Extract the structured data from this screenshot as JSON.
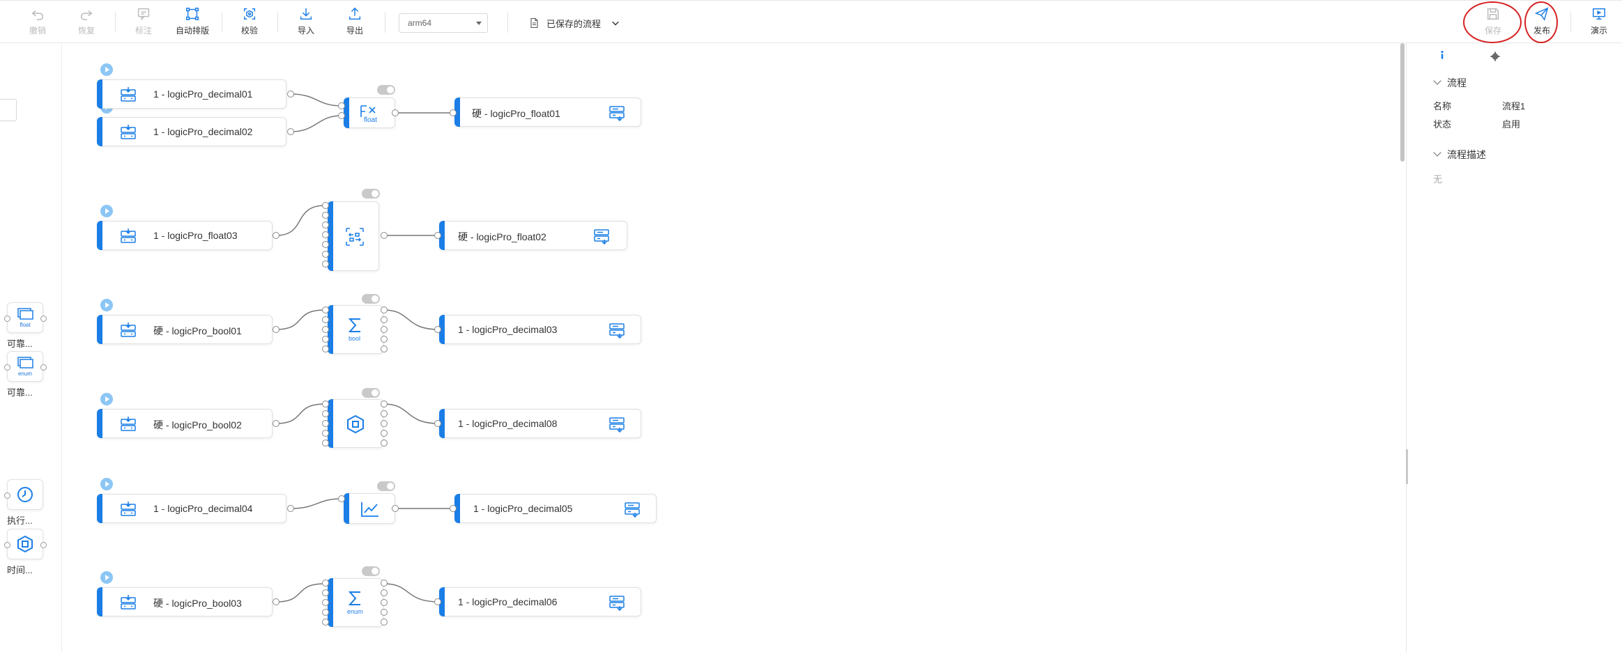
{
  "toolbar": {
    "undo": "撤销",
    "redo": "恢复",
    "annotate": "标注",
    "auto_layout": "自动排版",
    "validate": "校验",
    "import": "导入",
    "export": "导出",
    "arch_select": "arm64",
    "saved_flows": "已保存的流程",
    "save": "保存",
    "publish": "发布",
    "demo": "演示"
  },
  "palette": [
    {
      "label": "可靠...",
      "badge": "float"
    },
    {
      "label": "可靠...",
      "badge": "enum"
    },
    {
      "label": "执行...",
      "badge": ""
    },
    {
      "label": "时间...",
      "badge": ""
    }
  ],
  "flows": [
    {
      "inputs": [
        "1 - logicPro_decimal01",
        "1 - logicPro_decimal02"
      ],
      "func_badge": "float",
      "output": "硬 - logicPro_float01"
    },
    {
      "inputs": [
        "1 - logicPro_float03"
      ],
      "func_badge": "",
      "output": "硬 - logicPro_float02"
    },
    {
      "inputs": [
        "硬 - logicPro_bool01"
      ],
      "func_badge": "bool",
      "output": "1 - logicPro_decimal03"
    },
    {
      "inputs": [
        "硬 - logicPro_bool02"
      ],
      "func_badge": "",
      "output": "1 - logicPro_decimal08"
    },
    {
      "inputs": [
        "1 - logicPro_decimal04"
      ],
      "func_badge": "",
      "output": "1 - logicPro_decimal05"
    },
    {
      "inputs": [
        "硬 - logicPro_bool03"
      ],
      "func_badge": "enum",
      "output": "1 - logicPro_decimal06"
    }
  ],
  "properties": {
    "section_flow": "流程",
    "name_label": "名称",
    "name_value": "流程1",
    "status_label": "状态",
    "status_value": "启用",
    "section_desc": "流程描述",
    "desc_value": "无"
  },
  "colors": {
    "accent": "#1a7ee6",
    "annotation": "#d62121"
  }
}
